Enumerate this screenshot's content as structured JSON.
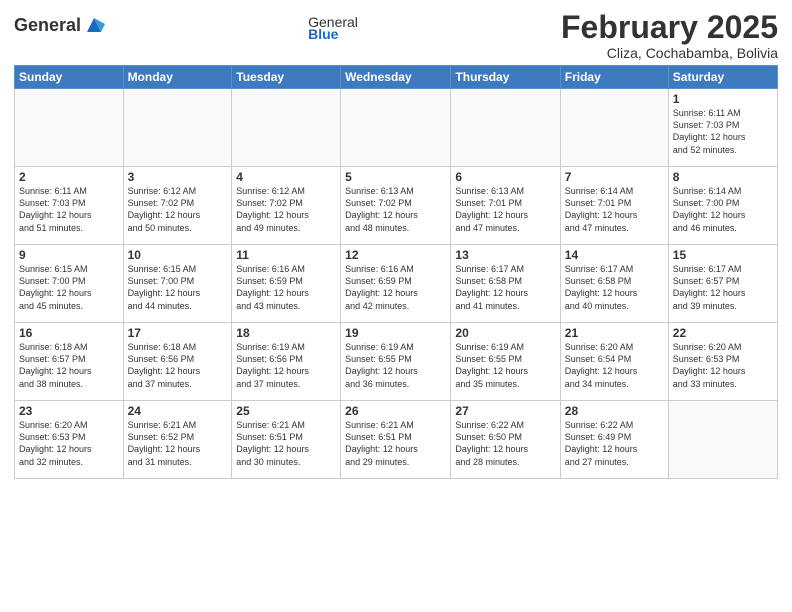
{
  "header": {
    "logo_general": "General",
    "logo_blue": "Blue",
    "month_title": "February 2025",
    "subtitle": "Cliza, Cochabamba, Bolivia"
  },
  "weekdays": [
    "Sunday",
    "Monday",
    "Tuesday",
    "Wednesday",
    "Thursday",
    "Friday",
    "Saturday"
  ],
  "weeks": [
    [
      {
        "day": "",
        "info": ""
      },
      {
        "day": "",
        "info": ""
      },
      {
        "day": "",
        "info": ""
      },
      {
        "day": "",
        "info": ""
      },
      {
        "day": "",
        "info": ""
      },
      {
        "day": "",
        "info": ""
      },
      {
        "day": "1",
        "info": "Sunrise: 6:11 AM\nSunset: 7:03 PM\nDaylight: 12 hours\nand 52 minutes."
      }
    ],
    [
      {
        "day": "2",
        "info": "Sunrise: 6:11 AM\nSunset: 7:03 PM\nDaylight: 12 hours\nand 51 minutes."
      },
      {
        "day": "3",
        "info": "Sunrise: 6:12 AM\nSunset: 7:02 PM\nDaylight: 12 hours\nand 50 minutes."
      },
      {
        "day": "4",
        "info": "Sunrise: 6:12 AM\nSunset: 7:02 PM\nDaylight: 12 hours\nand 49 minutes."
      },
      {
        "day": "5",
        "info": "Sunrise: 6:13 AM\nSunset: 7:02 PM\nDaylight: 12 hours\nand 48 minutes."
      },
      {
        "day": "6",
        "info": "Sunrise: 6:13 AM\nSunset: 7:01 PM\nDaylight: 12 hours\nand 47 minutes."
      },
      {
        "day": "7",
        "info": "Sunrise: 6:14 AM\nSunset: 7:01 PM\nDaylight: 12 hours\nand 47 minutes."
      },
      {
        "day": "8",
        "info": "Sunrise: 6:14 AM\nSunset: 7:00 PM\nDaylight: 12 hours\nand 46 minutes."
      }
    ],
    [
      {
        "day": "9",
        "info": "Sunrise: 6:15 AM\nSunset: 7:00 PM\nDaylight: 12 hours\nand 45 minutes."
      },
      {
        "day": "10",
        "info": "Sunrise: 6:15 AM\nSunset: 7:00 PM\nDaylight: 12 hours\nand 44 minutes."
      },
      {
        "day": "11",
        "info": "Sunrise: 6:16 AM\nSunset: 6:59 PM\nDaylight: 12 hours\nand 43 minutes."
      },
      {
        "day": "12",
        "info": "Sunrise: 6:16 AM\nSunset: 6:59 PM\nDaylight: 12 hours\nand 42 minutes."
      },
      {
        "day": "13",
        "info": "Sunrise: 6:17 AM\nSunset: 6:58 PM\nDaylight: 12 hours\nand 41 minutes."
      },
      {
        "day": "14",
        "info": "Sunrise: 6:17 AM\nSunset: 6:58 PM\nDaylight: 12 hours\nand 40 minutes."
      },
      {
        "day": "15",
        "info": "Sunrise: 6:17 AM\nSunset: 6:57 PM\nDaylight: 12 hours\nand 39 minutes."
      }
    ],
    [
      {
        "day": "16",
        "info": "Sunrise: 6:18 AM\nSunset: 6:57 PM\nDaylight: 12 hours\nand 38 minutes."
      },
      {
        "day": "17",
        "info": "Sunrise: 6:18 AM\nSunset: 6:56 PM\nDaylight: 12 hours\nand 37 minutes."
      },
      {
        "day": "18",
        "info": "Sunrise: 6:19 AM\nSunset: 6:56 PM\nDaylight: 12 hours\nand 37 minutes."
      },
      {
        "day": "19",
        "info": "Sunrise: 6:19 AM\nSunset: 6:55 PM\nDaylight: 12 hours\nand 36 minutes."
      },
      {
        "day": "20",
        "info": "Sunrise: 6:19 AM\nSunset: 6:55 PM\nDaylight: 12 hours\nand 35 minutes."
      },
      {
        "day": "21",
        "info": "Sunrise: 6:20 AM\nSunset: 6:54 PM\nDaylight: 12 hours\nand 34 minutes."
      },
      {
        "day": "22",
        "info": "Sunrise: 6:20 AM\nSunset: 6:53 PM\nDaylight: 12 hours\nand 33 minutes."
      }
    ],
    [
      {
        "day": "23",
        "info": "Sunrise: 6:20 AM\nSunset: 6:53 PM\nDaylight: 12 hours\nand 32 minutes."
      },
      {
        "day": "24",
        "info": "Sunrise: 6:21 AM\nSunset: 6:52 PM\nDaylight: 12 hours\nand 31 minutes."
      },
      {
        "day": "25",
        "info": "Sunrise: 6:21 AM\nSunset: 6:51 PM\nDaylight: 12 hours\nand 30 minutes."
      },
      {
        "day": "26",
        "info": "Sunrise: 6:21 AM\nSunset: 6:51 PM\nDaylight: 12 hours\nand 29 minutes."
      },
      {
        "day": "27",
        "info": "Sunrise: 6:22 AM\nSunset: 6:50 PM\nDaylight: 12 hours\nand 28 minutes."
      },
      {
        "day": "28",
        "info": "Sunrise: 6:22 AM\nSunset: 6:49 PM\nDaylight: 12 hours\nand 27 minutes."
      },
      {
        "day": "",
        "info": ""
      }
    ]
  ]
}
